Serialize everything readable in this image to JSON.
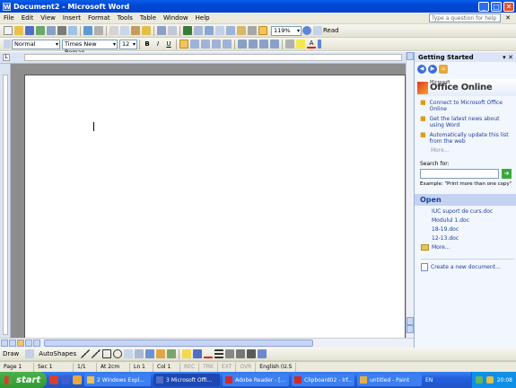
{
  "window": {
    "title": "Document2 - Microsoft Word"
  },
  "menu": {
    "items": [
      "File",
      "Edit",
      "View",
      "Insert",
      "Format",
      "Tools",
      "Table",
      "Window",
      "Help"
    ],
    "ask_placeholder": "Type a question for help"
  },
  "toolbar": {
    "zoom": "119%",
    "read_label": "Read"
  },
  "formatting": {
    "style": "Normal",
    "font": "Times New Roman",
    "size": "12",
    "bold": "B",
    "italic": "I",
    "underline": "U",
    "font_color_glyph": "A"
  },
  "task_pane": {
    "title": "Getting Started",
    "logo_small": "Microsoft",
    "logo_text": "Office Online",
    "links": [
      "Connect to Microsoft Office Online",
      "Get the latest news about using Word",
      "Automatically update this list from the web"
    ],
    "more": "More...",
    "search_label": "Search for:",
    "example": "Example: \"Print more than one copy\"",
    "open_title": "Open",
    "files": [
      "IUC suport de curs.doc",
      "Modulul 1.doc",
      "18-19.doc",
      "12-13.doc"
    ],
    "more_files": "More...",
    "create_new": "Create a new document..."
  },
  "drawbar": {
    "draw_label": "Draw",
    "autoshapes_label": "AutoShapes"
  },
  "status": {
    "page": "Page 1",
    "sec": "Sec 1",
    "pages": "1/1",
    "at": "At 2cm",
    "ln": "Ln 1",
    "col": "Col 1",
    "rec": "REC",
    "trk": "TRK",
    "ext": "EXT",
    "ovr": "OVR",
    "lang": "English (U.S"
  },
  "taskbar": {
    "start": "start",
    "tasks": [
      "2 Windows Expl...",
      "3 Microsoft Offi...",
      "Adobe Reader - [...",
      "Clipboard02 - Irf...",
      "untitled - Paint"
    ],
    "language": "EN",
    "clock": "20:08"
  }
}
